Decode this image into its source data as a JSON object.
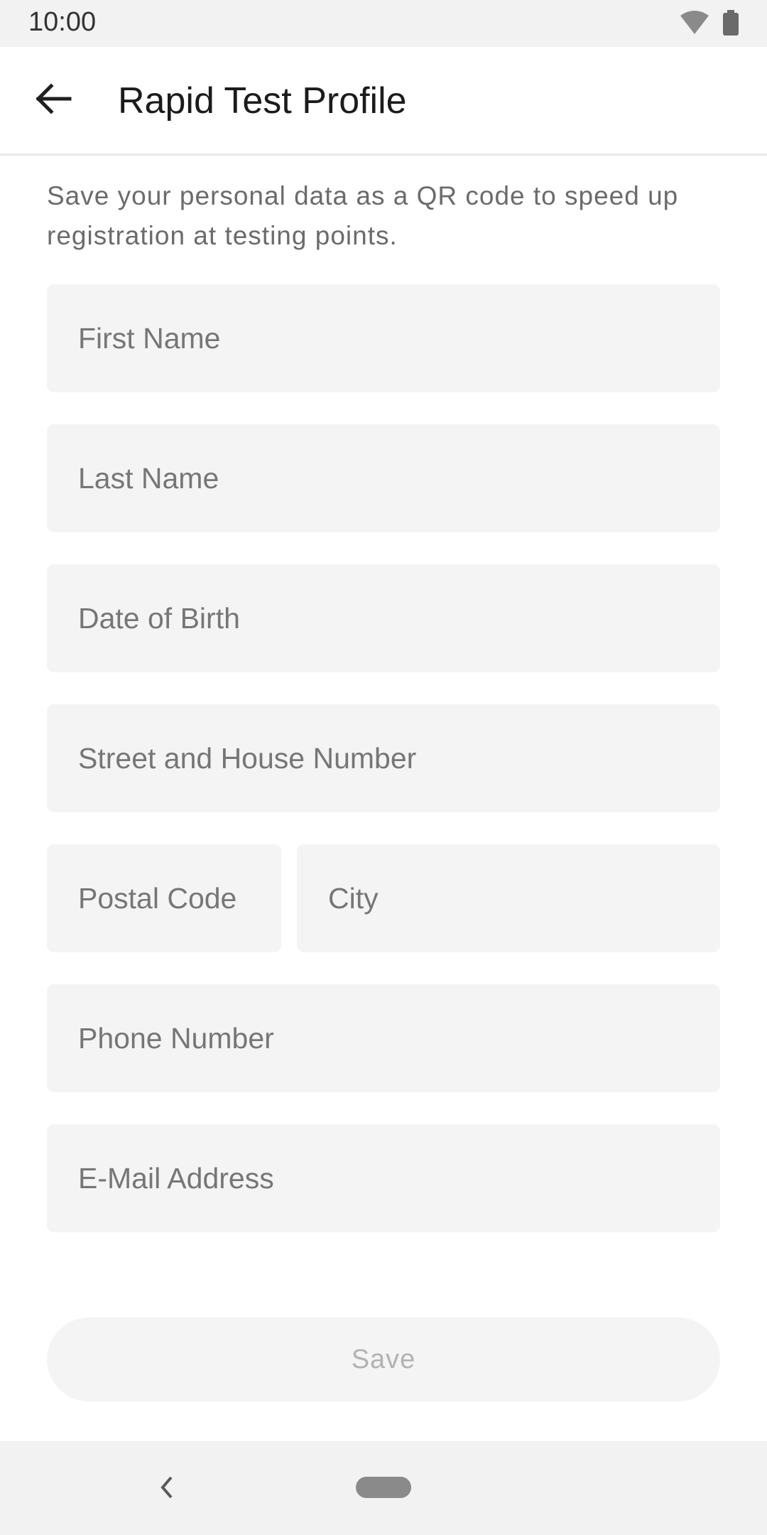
{
  "status_bar": {
    "time": "10:00",
    "icons": [
      "wifi-icon",
      "battery-icon"
    ]
  },
  "app_bar": {
    "title": "Rapid Test Profile",
    "back_icon": "arrow-left-icon"
  },
  "description": "Save your personal data as a QR code to speed up registration at testing points.",
  "form": {
    "first_name": {
      "placeholder": "First Name",
      "value": ""
    },
    "last_name": {
      "placeholder": "Last Name",
      "value": ""
    },
    "date_of_birth": {
      "placeholder": "Date of Birth",
      "value": ""
    },
    "street": {
      "placeholder": "Street and House Number",
      "value": ""
    },
    "postal_code": {
      "placeholder": "Postal Code",
      "value": ""
    },
    "city": {
      "placeholder": "City",
      "value": ""
    },
    "phone": {
      "placeholder": "Phone Number",
      "value": ""
    },
    "email": {
      "placeholder": "E-Mail Address",
      "value": ""
    }
  },
  "save_label": "Save",
  "nav_bar": {
    "back_icon": "chevron-left-icon",
    "home_icon": "home-pill-icon"
  },
  "colors": {
    "field_bg": "#f4f4f4",
    "placeholder": "#767676",
    "disabled_text": "#b2b2b2",
    "system_bar": "#f2f2f2"
  }
}
